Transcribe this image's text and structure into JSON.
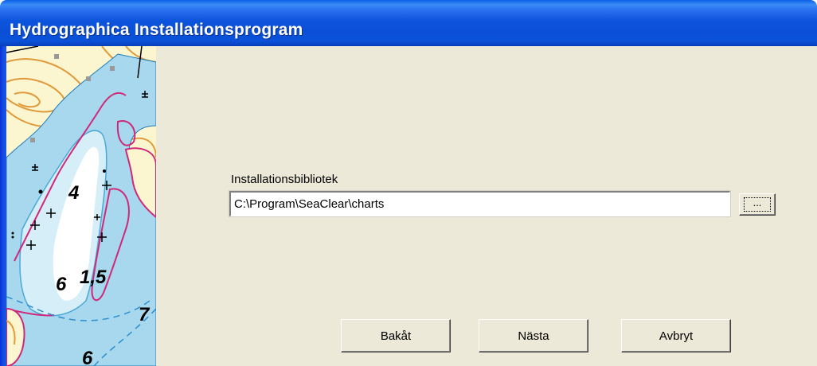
{
  "window": {
    "title": "Hydrographica Installationsprogram"
  },
  "map": {
    "depth_labels": [
      "4",
      "6",
      "1,5",
      "7",
      "6"
    ]
  },
  "install": {
    "label": "Installationsbibliotek",
    "path_value": "C:\\Program\\SeaClear\\charts",
    "browse_label": "..."
  },
  "buttons": {
    "back_label": "Bakåt",
    "next_label": "Nästa",
    "cancel_label": "Avbryt"
  },
  "colors": {
    "titlebar": "#0a54dd",
    "dialog_bg": "#ece9d8",
    "map_land": "#fbf6cf",
    "map_water": "#a8d8ee",
    "map_shallow": "#d6eef8",
    "map_contour_land": "#e09a3c",
    "map_contour_depth": "#d0287a"
  }
}
